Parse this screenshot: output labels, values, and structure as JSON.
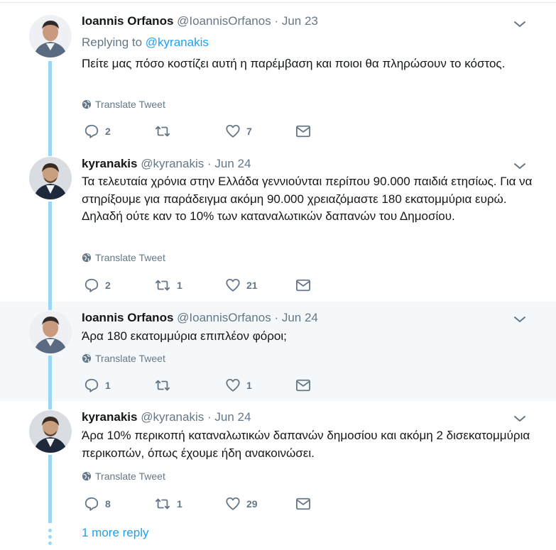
{
  "tweets": [
    {
      "name": "Ioannis Orfanos",
      "handle": "@IoannisOrfanos",
      "sep": "·",
      "date": "Jun 23",
      "replying_prefix": "Replying to",
      "replying_to": "@kyranakis",
      "text": "Πείτε μας πόσο κοστίζει αυτή η παρέμβαση και ποιοι θα πληρώσουν το κόστος.",
      "translate_label": "Translate Tweet",
      "replies": "2",
      "retweets": "",
      "likes": "7",
      "avatar": "avatar-ioannis-orfanos"
    },
    {
      "name": "kyranakis",
      "handle": "@kyranakis",
      "sep": "·",
      "date": "Jun 24",
      "text": "Τα τελευταία χρόνια στην Ελλάδα γεννιούνται περίπου 90.000 παιδιά ετησίως. Για να στηρίξουμε για παράδειγμα ακόμη 90.000 χρειαζόμαστε 180 εκατομμύρια ευρώ. Δηλαδή ούτε καν το 10% των καταναλωτικών δαπανών του Δημοσίου.",
      "translate_label": "Translate Tweet",
      "replies": "2",
      "retweets": "1",
      "likes": "21",
      "avatar": "avatar-kyranakis"
    },
    {
      "name": "Ioannis Orfanos",
      "handle": "@IoannisOrfanos",
      "sep": "·",
      "date": "Jun 24",
      "text": "Άρα 180 εκατομμύρια επιπλέον φόροι;",
      "translate_label": "Translate Tweet",
      "replies": "1",
      "retweets": "",
      "likes": "1",
      "avatar": "avatar-ioannis-orfanos"
    },
    {
      "name": "kyranakis",
      "handle": "@kyranakis",
      "sep": "·",
      "date": "Jun 24",
      "text": "Άρα 10% περικοπή καταναλωτικών δαπανών δημοσίου και ακόμη 2 δισεκατομμύρια περικοπών, όπως έχουμε ήδη ανακοινώσει.",
      "translate_label": "Translate Tweet",
      "replies": "8",
      "retweets": "1",
      "likes": "29",
      "avatar": "avatar-kyranakis"
    }
  ],
  "more_replies": "1 more reply",
  "colors": {
    "accent": "#1da1f2",
    "muted": "#657786",
    "thread_line": "#9bd6f5",
    "highlight_bg": "#f5f8fa"
  },
  "icons": [
    "reply-icon",
    "retweet-icon",
    "like-icon",
    "message-icon",
    "globe-icon",
    "chevron-down-icon"
  ]
}
